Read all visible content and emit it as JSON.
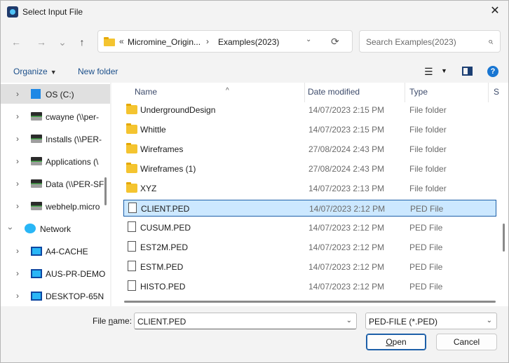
{
  "window": {
    "title": "Select Input File",
    "close_glyph": "✕"
  },
  "nav": {
    "back": "←",
    "forward": "→",
    "recent": "⌄",
    "up": "↑"
  },
  "address": {
    "overflow": "«",
    "segments": [
      "Micromine_Origin...",
      "Examples(2023)"
    ],
    "separator": "›",
    "dropdown": "⌄",
    "refresh": "⟳"
  },
  "search": {
    "placeholder": "Search Examples(2023)",
    "icon": "⌕"
  },
  "toolbar": {
    "organize": "Organize",
    "new_folder": "New folder",
    "view_icon": "☰",
    "help": "?"
  },
  "sidebar": {
    "items": [
      {
        "label": "OS (C:)",
        "icon": "windows-drive-icon",
        "selected": true
      },
      {
        "label": "cwayne (\\\\per-",
        "icon": "network-drive-icon"
      },
      {
        "label": "Installs (\\\\PER-",
        "icon": "network-drive-icon"
      },
      {
        "label": "Applications (\\",
        "icon": "network-drive-icon"
      },
      {
        "label": "Data (\\\\PER-SF",
        "icon": "network-drive-icon"
      },
      {
        "label": "webhelp.micro",
        "icon": "network-drive-icon"
      },
      {
        "label": "Network",
        "icon": "network-icon",
        "expanded": true
      },
      {
        "label": "A4-CACHE",
        "icon": "computer-icon"
      },
      {
        "label": "AUS-PR-DEMO",
        "icon": "computer-icon"
      },
      {
        "label": "DESKTOP-65N",
        "icon": "computer-icon"
      }
    ]
  },
  "columns": {
    "name": "Name",
    "date": "Date modified",
    "type": "Type",
    "size": "S"
  },
  "files": [
    {
      "name": "UndergroundDesign",
      "date": "14/07/2023 2:15 PM",
      "type": "File folder",
      "kind": "folder"
    },
    {
      "name": "Whittle",
      "date": "14/07/2023 2:15 PM",
      "type": "File folder",
      "kind": "folder"
    },
    {
      "name": "Wireframes",
      "date": "27/08/2024 2:43 PM",
      "type": "File folder",
      "kind": "folder"
    },
    {
      "name": "Wireframes (1)",
      "date": "27/08/2024 2:43 PM",
      "type": "File folder",
      "kind": "folder"
    },
    {
      "name": "XYZ",
      "date": "14/07/2023 2:13 PM",
      "type": "File folder",
      "kind": "folder"
    },
    {
      "name": "CLIENT.PED",
      "date": "14/07/2023 2:12 PM",
      "type": "PED File",
      "kind": "file",
      "selected": true
    },
    {
      "name": "CUSUM.PED",
      "date": "14/07/2023 2:12 PM",
      "type": "PED File",
      "kind": "file"
    },
    {
      "name": "EST2M.PED",
      "date": "14/07/2023 2:12 PM",
      "type": "PED File",
      "kind": "file"
    },
    {
      "name": "ESTM.PED",
      "date": "14/07/2023 2:12 PM",
      "type": "PED File",
      "kind": "file"
    },
    {
      "name": "HISTO.PED",
      "date": "14/07/2023 2:12 PM",
      "type": "PED File",
      "kind": "file"
    }
  ],
  "footer": {
    "file_name_label_pre": "File ",
    "file_name_label_u": "n",
    "file_name_label_post": "ame:",
    "file_name_value": "CLIENT.PED",
    "file_type_value": "PED-FILE (*.PED)",
    "open_u": "O",
    "open_rest": "pen",
    "cancel": "Cancel",
    "dropdown": "⌄"
  }
}
